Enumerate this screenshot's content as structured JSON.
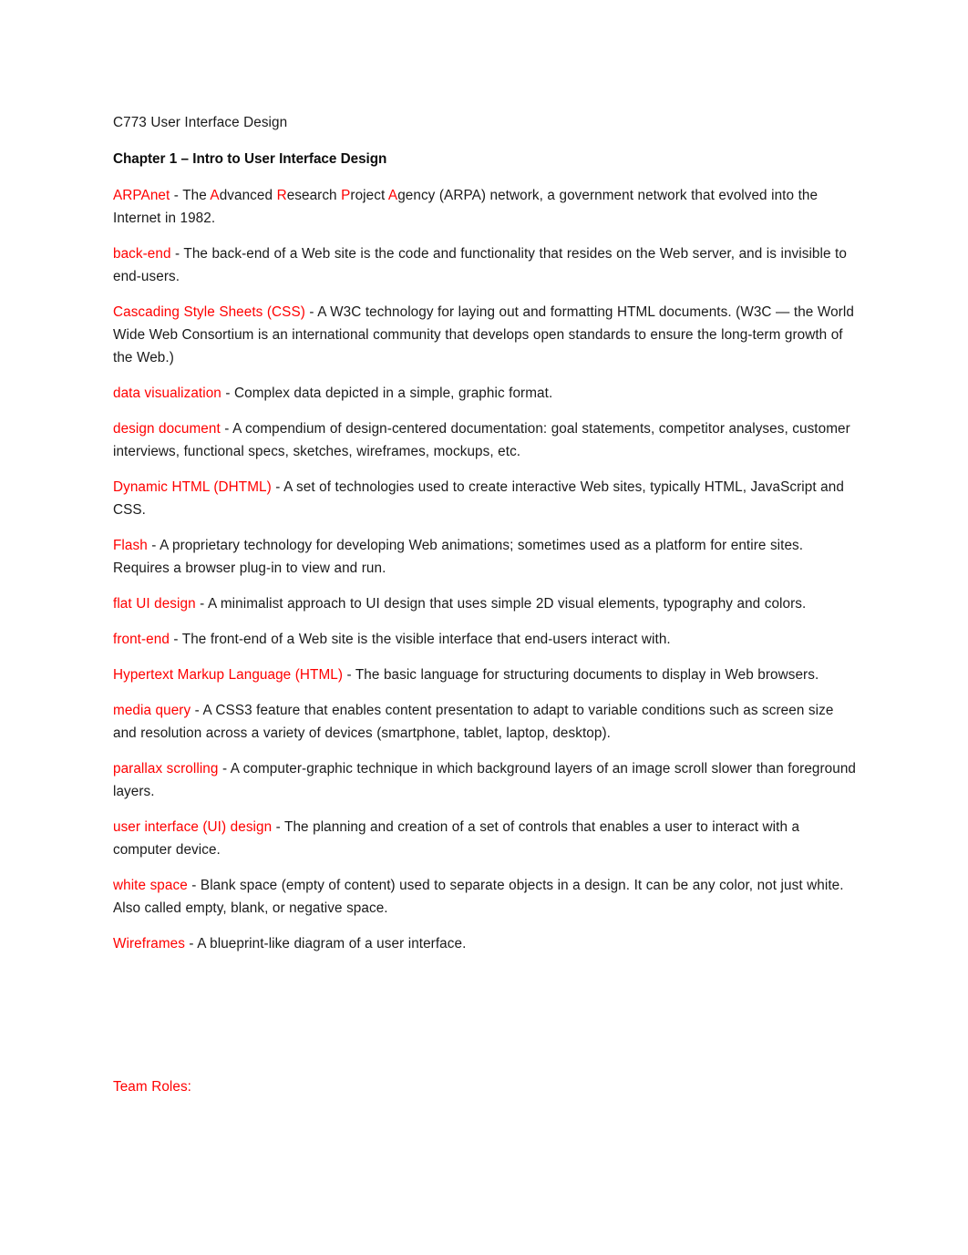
{
  "document": {
    "title_line": "C773 User Interface Design",
    "chapter_heading": "Chapter 1 – Intro to User Interface Design",
    "accent_color": "#FF0000",
    "text_color": "#1a1a1a",
    "glossary": [
      {
        "term": "ARPAnet",
        "separator": " - ",
        "definition_parts": [
          {
            "text": "The ",
            "color": "black"
          },
          {
            "text": "A",
            "color": "red"
          },
          {
            "text": "dvanced ",
            "color": "black"
          },
          {
            "text": "R",
            "color": "red"
          },
          {
            "text": "esearch ",
            "color": "black"
          },
          {
            "text": "P",
            "color": "red"
          },
          {
            "text": "roject ",
            "color": "black"
          },
          {
            "text": "A",
            "color": "red"
          },
          {
            "text": "gency (ARPA) network, a government network that evolved into the Internet in 1982.",
            "color": "black"
          }
        ]
      },
      {
        "term": "back-end",
        "separator": " - ",
        "definition": "The back-end of a Web site is the code and functionality that resides on the Web server, and is invisible to end-users."
      },
      {
        "term": "Cascading Style Sheets (CSS)",
        "separator": " - ",
        "definition": "A W3C technology for laying out and formatting HTML documents. (W3C — the World Wide Web Consortium is an international community that develops open standards to ensure the long-term growth of the Web.)"
      },
      {
        "term": "data visualization",
        "separator": " - ",
        "definition": "Complex data depicted in a simple, graphic format."
      },
      {
        "term": "design document",
        "separator": " - ",
        "definition": "A compendium of design-centered documentation: goal statements, competitor analyses, customer interviews, functional specs, sketches, wireframes, mockups, etc."
      },
      {
        "term": "Dynamic HTML (DHTML)",
        "separator": " - ",
        "definition": "A set of technologies used to create interactive Web sites, typically HTML, JavaScript and CSS."
      },
      {
        "term": "Flash",
        "separator": " - ",
        "definition": "A proprietary technology for developing Web animations; sometimes used as a platform for entire sites. Requires a browser plug-in to view and run."
      },
      {
        "term": "flat UI design",
        "separator": " - ",
        "definition": "A minimalist approach to UI design that uses simple 2D visual elements, typography and colors."
      },
      {
        "term": "front-end",
        "separator": " - ",
        "definition": "The front-end of a Web site is the visible interface that end-users interact with."
      },
      {
        "term": "Hypertext Markup Language (HTML)",
        "separator": " - ",
        "definition": "The basic language for structuring documents to display in Web browsers."
      },
      {
        "term": "media query",
        "separator": " - ",
        "definition": "A CSS3 feature that enables content presentation to adapt to variable conditions such as screen size and resolution across a variety of devices (smartphone, tablet, laptop, desktop)."
      },
      {
        "term": "parallax scrolling",
        "separator": " - ",
        "definition": "A computer-graphic technique in which background layers of an image scroll slower than foreground layers."
      },
      {
        "term": "user interface (UI) design",
        "separator": " - ",
        "definition": "The planning and creation of a set of controls that enables a user to interact with a computer device."
      },
      {
        "term": "white space",
        "separator": " - ",
        "definition": "Blank space (empty of content) used to separate objects in a design. It can be any color, not just white. Also called empty, blank, or negative space."
      },
      {
        "term": "Wireframes",
        "separator": " - ",
        "definition": "A blueprint-like diagram of a user interface."
      }
    ],
    "team_roles_heading": "Team Roles:"
  }
}
